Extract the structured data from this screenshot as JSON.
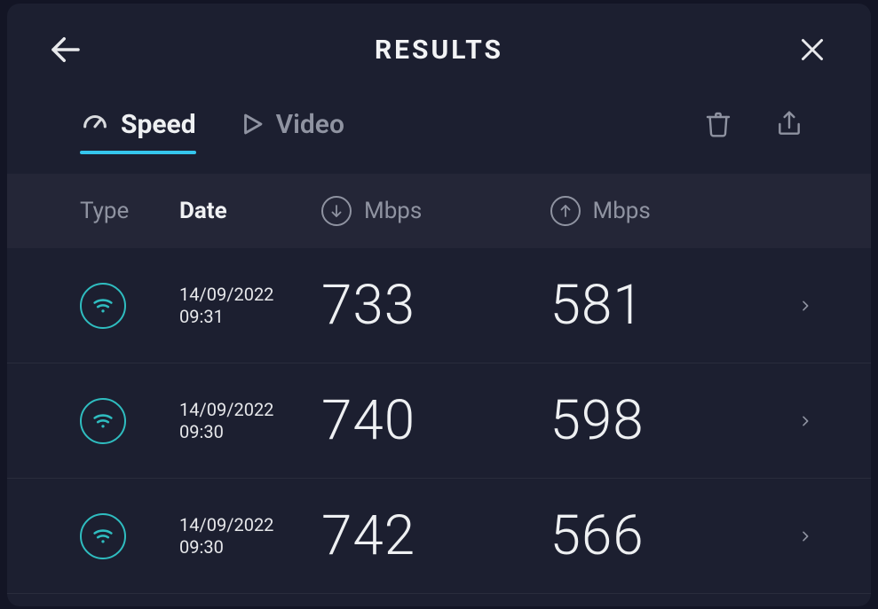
{
  "header": {
    "title": "RESULTS"
  },
  "tabs": {
    "speed": "Speed",
    "video": "Video"
  },
  "columns": {
    "type": "Type",
    "date": "Date",
    "mbps": "Mbps"
  },
  "results": [
    {
      "date": "14/09/2022",
      "time": "09:31",
      "down": "733",
      "up": "581"
    },
    {
      "date": "14/09/2022",
      "time": "09:30",
      "down": "740",
      "up": "598"
    },
    {
      "date": "14/09/2022",
      "time": "09:30",
      "down": "742",
      "up": "566"
    }
  ]
}
